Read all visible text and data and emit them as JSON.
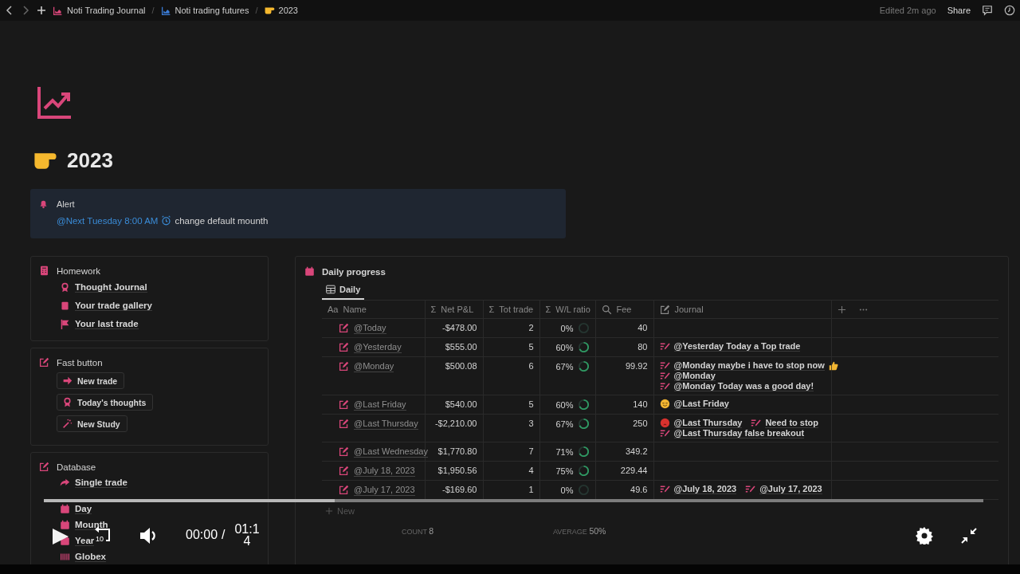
{
  "topbar": {
    "breadcrumb": [
      {
        "label": "Noti Trading Journal",
        "color": "#d9467a",
        "kind": "chart"
      },
      {
        "prefix": "/",
        "label": "Noti trading futures",
        "color": "#3a7bd5",
        "kind": "chart"
      },
      {
        "prefix": "/",
        "label": "2023",
        "color": "#f5b82e",
        "kind": "pointer"
      }
    ],
    "edited": "Edited 2m ago",
    "share": "Share"
  },
  "page": {
    "title": "2023"
  },
  "alert": {
    "title": "Alert",
    "mention": "@Next Tuesday 8:00 AM",
    "text": "change default mounth"
  },
  "homework": {
    "title": "Homework",
    "items": [
      {
        "label": "Thought Journal",
        "kind": "ribbon"
      },
      {
        "label": "Your trade gallery",
        "kind": "book"
      },
      {
        "label": "Your last trade",
        "kind": "flag"
      }
    ]
  },
  "fast_button": {
    "title": "Fast button",
    "buttons": [
      {
        "label": "New trade",
        "kind": "arrow"
      },
      {
        "label": "Today's thoughts",
        "kind": "ribbon"
      },
      {
        "label": "New Study",
        "kind": "wand"
      }
    ]
  },
  "database": {
    "title": "Database",
    "items": [
      {
        "label": "Single trade",
        "kind": "share"
      },
      {
        "label": "Day",
        "kind": "calendar"
      },
      {
        "label": "Mounth",
        "kind": "calendar"
      },
      {
        "label": "Year",
        "kind": "calendar"
      },
      {
        "label": "Globex",
        "kind": "barcode"
      }
    ]
  },
  "daily": {
    "title": "Daily progress",
    "tabs": [
      {
        "label": "Daily",
        "selected": true
      }
    ],
    "columns": [
      {
        "glyph": "Aa",
        "label": "Name"
      },
      {
        "glyph": "Σ",
        "label": "Net P&L"
      },
      {
        "glyph": "Σ",
        "label": "Tot trade"
      },
      {
        "glyph": "Σ",
        "label": "W/L ratio"
      },
      {
        "kind": "search",
        "label": "Fee"
      },
      {
        "kind": "edit",
        "label": "Journal"
      }
    ],
    "rows": [
      {
        "name": "@Today",
        "pnl": "-$478.00",
        "trades": "2",
        "ratio": "0%",
        "ring_filled": false,
        "fee": "40",
        "journal": []
      },
      {
        "name": "@Yesterday",
        "pnl": "$555.00",
        "trades": "5",
        "ratio": "60%",
        "ring_filled": true,
        "fee": "80",
        "journal": [
          [
            {
              "kind": "note",
              "text": "@Yesterday Today a Top trade"
            }
          ]
        ]
      },
      {
        "name": "@Monday",
        "pnl": "$500.08",
        "trades": "6",
        "ratio": "67%",
        "ring_filled": true,
        "fee": "99.92",
        "journal": [
          [
            {
              "kind": "note",
              "text": "@Monday maybe i have to stop now",
              "thumbs_up": true
            }
          ],
          [
            {
              "kind": "note",
              "text": "@Monday"
            }
          ],
          [
            {
              "kind": "note",
              "text": "@Monday Today was a good day!"
            }
          ]
        ]
      },
      {
        "name": "@Last Friday",
        "pnl": "$540.00",
        "trades": "5",
        "ratio": "60%",
        "ring_filled": true,
        "fee": "140",
        "journal": [
          [
            {
              "kind": "happy",
              "text": "@Last Friday"
            }
          ]
        ]
      },
      {
        "name": "@Last Thursday",
        "pnl": "-$2,210.00",
        "trades": "3",
        "ratio": "67%",
        "ring_filled": true,
        "fee": "250",
        "journal": [
          [
            {
              "kind": "angry",
              "text": "@Last Thursday"
            },
            {
              "kind": "note",
              "text": "Need to stop"
            }
          ],
          [
            {
              "kind": "note",
              "text": "@Last Thursday false breakout"
            }
          ]
        ]
      },
      {
        "name": "@Last Wednesday",
        "pnl": "$1,770.80",
        "trades": "7",
        "ratio": "71%",
        "ring_filled": true,
        "fee": "349.2",
        "journal": []
      },
      {
        "name": "@July 18, 2023",
        "pnl": "$1,950.56",
        "trades": "4",
        "ratio": "75%",
        "ring_filled": true,
        "fee": "229.44",
        "journal": []
      },
      {
        "name": "@July 17, 2023",
        "pnl": "-$169.60",
        "trades": "1",
        "ratio": "0%",
        "ring_filled": false,
        "fee": "49.6",
        "journal": [
          [
            {
              "kind": "note",
              "text": "@July 18, 2023"
            },
            {
              "kind": "note",
              "text": "@July 17, 2023"
            }
          ]
        ]
      }
    ],
    "new_label": "New",
    "footer": {
      "count_label": "COUNT",
      "count": "8",
      "average_label": "AVERAGE",
      "average": "50%"
    }
  },
  "video": {
    "level": 0.31,
    "elapsed": "00:00",
    "separator": "/",
    "total": "01:14",
    "replay_seconds": "10"
  }
}
